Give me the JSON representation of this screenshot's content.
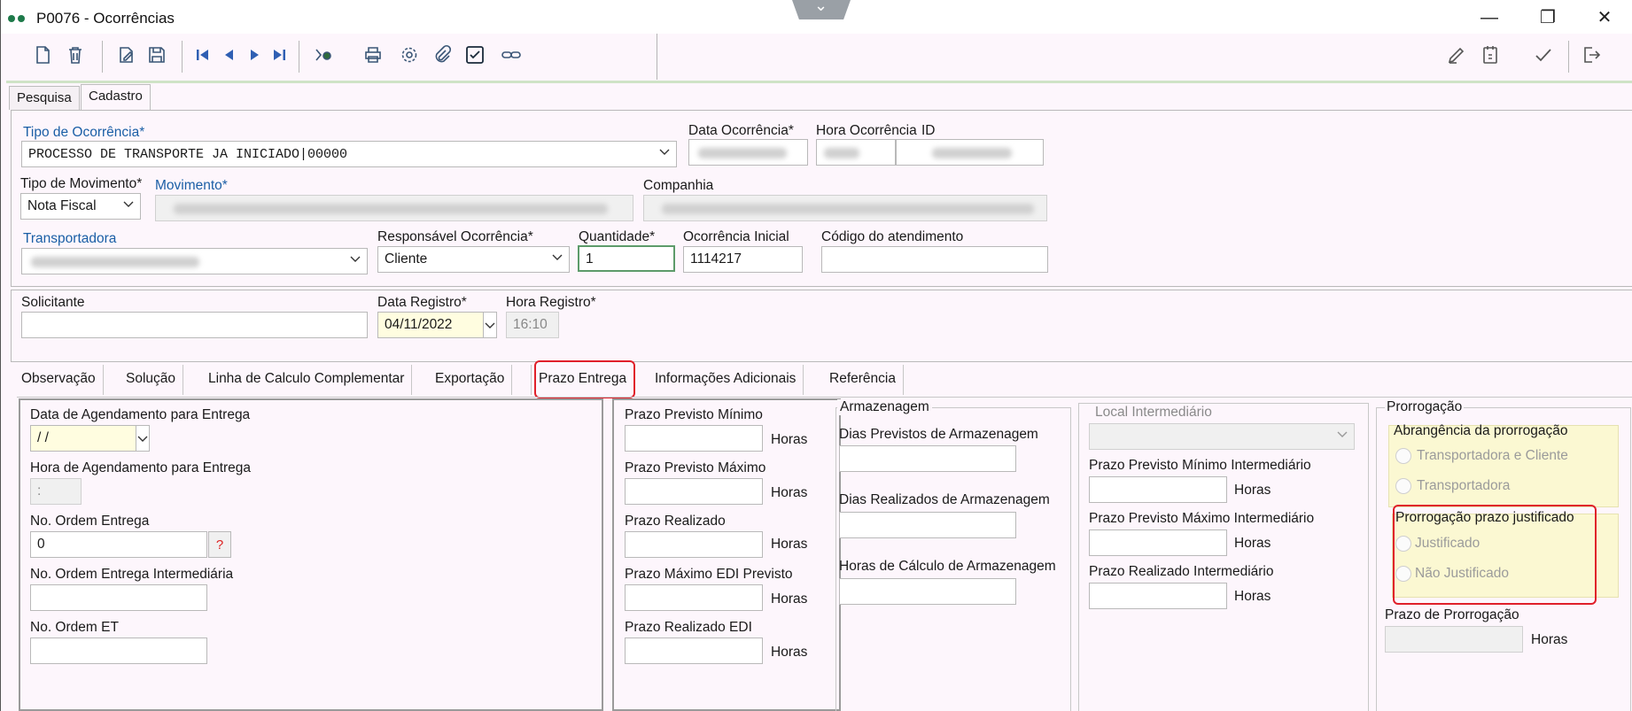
{
  "window": {
    "title": "P0076 - Ocorrências",
    "controls": {
      "minimize": "—",
      "maximize": "❐",
      "close": "✕"
    }
  },
  "toolbar": {
    "buttons": [
      "new-icon",
      "delete-icon",
      "edit-icon",
      "save-icon",
      "first-icon",
      "previous-icon",
      "next-icon",
      "last-icon",
      "search-icon",
      "print-icon",
      "settings-icon",
      "attach-icon",
      "check-icon",
      "link-icon"
    ],
    "right_buttons": [
      "pen-icon",
      "calendar-icon",
      "confirm-icon",
      "exit-icon"
    ]
  },
  "main_tabs": [
    "Pesquisa",
    "Cadastro"
  ],
  "cadastro": {
    "tipo_ocorrencia": {
      "label": "Tipo de Ocorrência*",
      "value": "PROCESSO DE TRANSPORTE JA INICIADO|00000"
    },
    "data_ocorrencia": {
      "label": "Data Ocorrência*"
    },
    "hora_ocorrencia": {
      "label": "Hora Ocorrência"
    },
    "id": {
      "label": "ID"
    },
    "tipo_movimento": {
      "label": "Tipo de Movimento*",
      "value": "Nota Fiscal"
    },
    "movimento": {
      "label": "Movimento*"
    },
    "companhia": {
      "label": "Companhia"
    },
    "transportadora": {
      "label": "Transportadora"
    },
    "responsavel": {
      "label": "Responsável Ocorrência*",
      "value": "Cliente"
    },
    "quantidade": {
      "label": "Quantidade*",
      "value": "1"
    },
    "ocorrencia_inicial": {
      "label": "Ocorrência Inicial",
      "value": "1114217"
    },
    "codigo_atendimento": {
      "label": "Código do atendimento",
      "value": ""
    },
    "solicitante": {
      "label": "Solicitante",
      "value": ""
    },
    "data_registro": {
      "label": "Data Registro*",
      "value": "04/11/2022"
    },
    "hora_registro": {
      "label": "Hora Registro*",
      "value": "16:10"
    }
  },
  "sub_tabs": [
    "Observação",
    "Solução",
    "Linha de Calculo Complementar",
    "Exportação",
    "Prazo Entrega",
    "Informações Adicionais",
    "Referência"
  ],
  "prazo_entrega": {
    "agendamento": {
      "data_label": "Data de Agendamento para Entrega",
      "data_value": " / /",
      "hora_label": "Hora de Agendamento para Entrega",
      "hora_value": ":",
      "ordem_label": "No. Ordem Entrega",
      "ordem_value": "0",
      "help": "?",
      "ordem_inter_label": "No. Ordem Entrega Intermediária",
      "ordem_et_label": "No. Ordem ET"
    },
    "prazos": {
      "hours_unit": "Horas",
      "fields": [
        "Prazo Previsto Mínimo",
        "Prazo Previsto Máximo",
        "Prazo Realizado",
        "Prazo Máximo EDI Previsto",
        "Prazo Realizado EDI"
      ]
    },
    "armazenagem": {
      "title": "Armazenagem",
      "fields": [
        "Dias Previstos de Armazenagem",
        "Dias Realizados de Armazenagem",
        "Horas de Cálculo de Armazenagem"
      ]
    },
    "local_intermediario": {
      "title": "Local Intermediário",
      "fields": [
        "Prazo Previsto Mínimo Intermediário",
        "Prazo Previsto Máximo Intermediário",
        "Prazo Realizado Intermediário"
      ]
    },
    "prorrogacao": {
      "title": "Prorrogação",
      "abrangencia_title": "Abrangência da prorrogação",
      "abrangencia_options": [
        "Transportadora e Cliente",
        "Transportadora"
      ],
      "justificado_title": "Prorrogação prazo justificado",
      "justificado_options": [
        "Justificado",
        "Não Justificado"
      ],
      "prazo_label": "Prazo de Prorrogação"
    }
  },
  "colors": {
    "accent_highlight": "#e0202a",
    "field_yellow": "#fffde0",
    "label_blue": "#1b5fa6"
  }
}
